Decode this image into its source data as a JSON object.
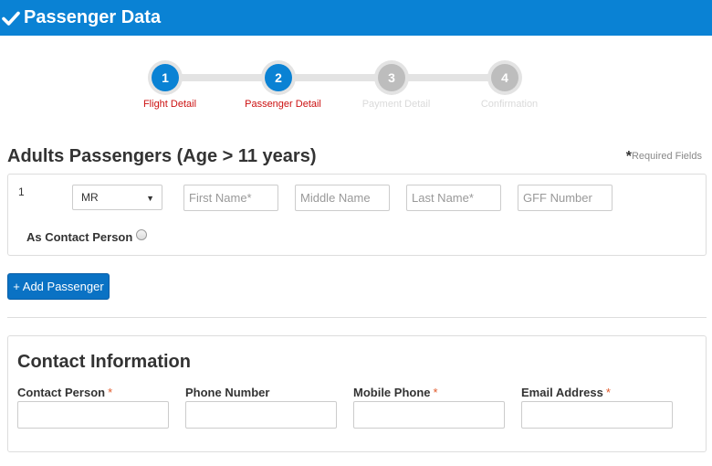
{
  "header": {
    "title": "Passenger Data",
    "icon": "checkmark-icon",
    "bg_color": "#0a82d4"
  },
  "steps": [
    {
      "number": "1",
      "label": "Flight Detail",
      "state": "active"
    },
    {
      "number": "2",
      "label": "Passenger Detail",
      "state": "active"
    },
    {
      "number": "3",
      "label": "Payment Detail",
      "state": "inactive"
    },
    {
      "number": "4",
      "label": "Confirmation",
      "state": "inactive"
    }
  ],
  "adults": {
    "title": "Adults Passengers (Age > 11 years)",
    "required_star": "*",
    "required_note": "Required Fields",
    "passenger": {
      "number": "1",
      "title_value": "MR",
      "first_name_placeholder": "First Name*",
      "middle_name_placeholder": "Middle Name",
      "last_name_placeholder": "Last Name*",
      "gff_placeholder": "GFF Number",
      "contact_toggle_label": "As Contact Person"
    },
    "add_button": "+ Add Passenger"
  },
  "contact": {
    "title": "Contact Information",
    "fields": [
      {
        "label": "Contact Person",
        "required": "*"
      },
      {
        "label": "Phone Number",
        "required": ""
      },
      {
        "label": "Mobile Phone",
        "required": "*"
      },
      {
        "label": "Email Address",
        "required": "*"
      }
    ]
  }
}
